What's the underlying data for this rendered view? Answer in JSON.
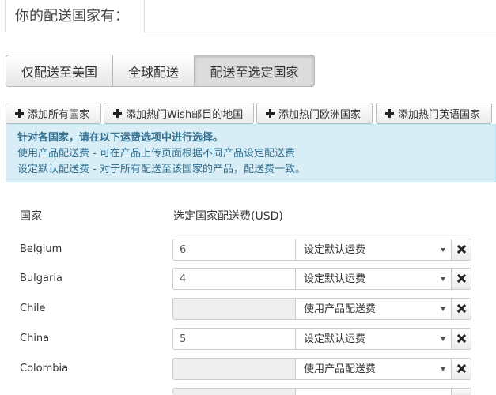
{
  "header": {
    "title": "你的配送国家有："
  },
  "mode_toggle": {
    "options": [
      "仅配送至美国",
      "全球配送",
      "配送至选定国家"
    ],
    "selected": "配送至选定国家"
  },
  "add_buttons": [
    "添加所有国家",
    "添加热门Wish邮目的地国",
    "添加热门欧洲国家",
    "添加热门英语国家"
  ],
  "info": {
    "heading": "针对各国家，请在以下运费选项中进行选择。",
    "line1": "使用产品配送费 - 可在产品上传页面根据不同产品设定配送费",
    "line2": "设定默认配送费 - 对于所有配送至该国家的产品，配送费一致。"
  },
  "table": {
    "col_country": "国家",
    "col_fee": "选定国家配送费(USD)",
    "rows": [
      {
        "country": "Belgium",
        "fee": "6",
        "option": "设定默认运费",
        "disabled": false
      },
      {
        "country": "Bulgaria",
        "fee": "4",
        "option": "设定默认运费",
        "disabled": false
      },
      {
        "country": "Chile",
        "fee": "",
        "option": "使用产品配送费",
        "disabled": true
      },
      {
        "country": "China",
        "fee": "5",
        "option": "设定默认运费",
        "disabled": false
      },
      {
        "country": "Colombia",
        "fee": "",
        "option": "使用产品配送费",
        "disabled": true
      }
    ]
  },
  "icons": {
    "add": "plus-icon",
    "remove": "x-icon",
    "dropdown": "caret-down-icon"
  }
}
